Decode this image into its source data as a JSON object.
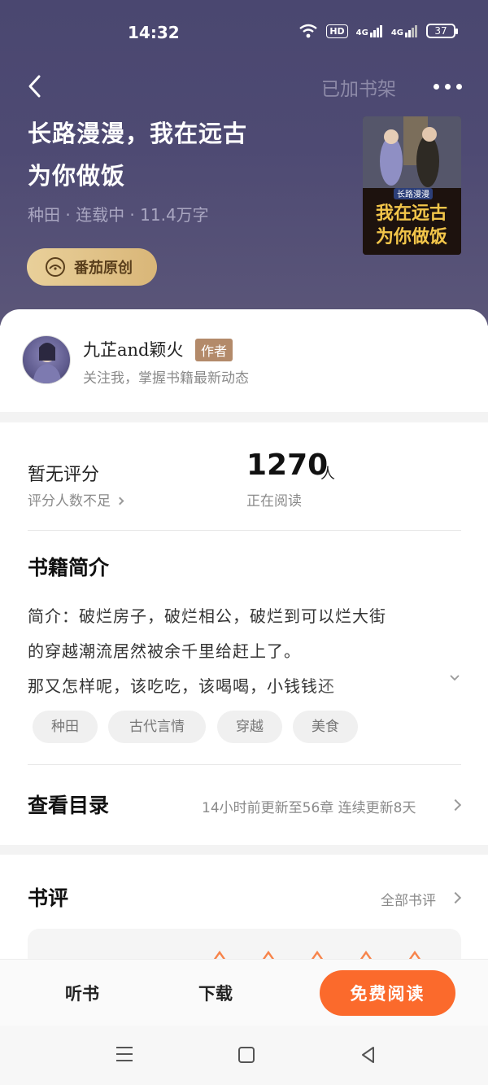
{
  "status_bar": {
    "time": "14:32",
    "network_hd": "HD",
    "network_4g_1": "4G",
    "network_4g_2": "4G",
    "battery": "37",
    "icons": [
      "wifi-icon",
      "hd-icon",
      "signal-4g-icon",
      "signal-4g-icon",
      "battery-icon"
    ]
  },
  "header": {
    "back_icon": "chevron-left-icon",
    "shelf_status": "已加书架",
    "more_icon": "more-dots-icon"
  },
  "book": {
    "title_line1": "长路漫漫，我在远古",
    "title_line2": "为你做饭",
    "meta": "种田 · 连载中 · 11.4万字",
    "origin_badge": "番茄原创",
    "cover_line1": "长路漫漫",
    "cover_line2": "我在远古",
    "cover_line3": "为你做饭"
  },
  "author": {
    "name": "九芷and颖火",
    "tag": "作者",
    "subtitle": "关注我，掌握书籍最新动态"
  },
  "stats": {
    "rating_title": "暂无评分",
    "rating_sub": "评分人数不足",
    "readers_count": "1270",
    "readers_unit": "人",
    "readers_sub": "正在阅读"
  },
  "intro": {
    "heading": "书籍简介",
    "line1": "简介：破烂房子，破烂相公，破烂到可以烂大街",
    "line2": "的穿越潮流居然被余千里给赶上了。",
    "line3": "那又怎样呢，该吃吃，该喝喝，小钱钱还",
    "tags": [
      "种田",
      "古代言情",
      "穿越",
      "美食"
    ]
  },
  "toc": {
    "title": "查看目录",
    "update_info": "14小时前更新至56章 连续更新8天"
  },
  "reviews": {
    "title": "书评",
    "all_link": "全部书评"
  },
  "action_bar": {
    "listen": "听书",
    "download": "下载",
    "read": "免费阅读"
  },
  "nav_bar": {
    "icons": [
      "menu-icon",
      "home-square-icon",
      "back-triangle-icon"
    ]
  },
  "colors": {
    "hero_bg": "#4e4a73",
    "accent_orange": "#fb6a2c",
    "badge_gold": "#e2c48b",
    "author_tag": "#b38a6a"
  }
}
